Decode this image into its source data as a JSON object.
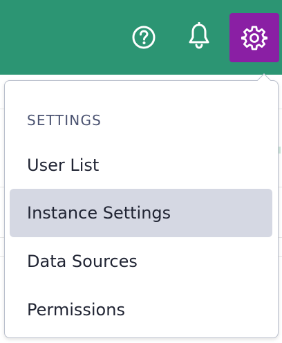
{
  "topbar": {
    "color": "#2c9573",
    "icons": [
      "help-icon",
      "bell-icon",
      "gear-icon"
    ],
    "settings_active_color": "#8a1fa4"
  },
  "dropdown": {
    "header": "SETTINGS",
    "items": [
      {
        "label": "User List",
        "selected": false
      },
      {
        "label": "Instance Settings",
        "selected": true
      },
      {
        "label": "Data Sources",
        "selected": false
      },
      {
        "label": "Permissions",
        "selected": false
      }
    ],
    "highlight_color": "#d5d8e3"
  }
}
